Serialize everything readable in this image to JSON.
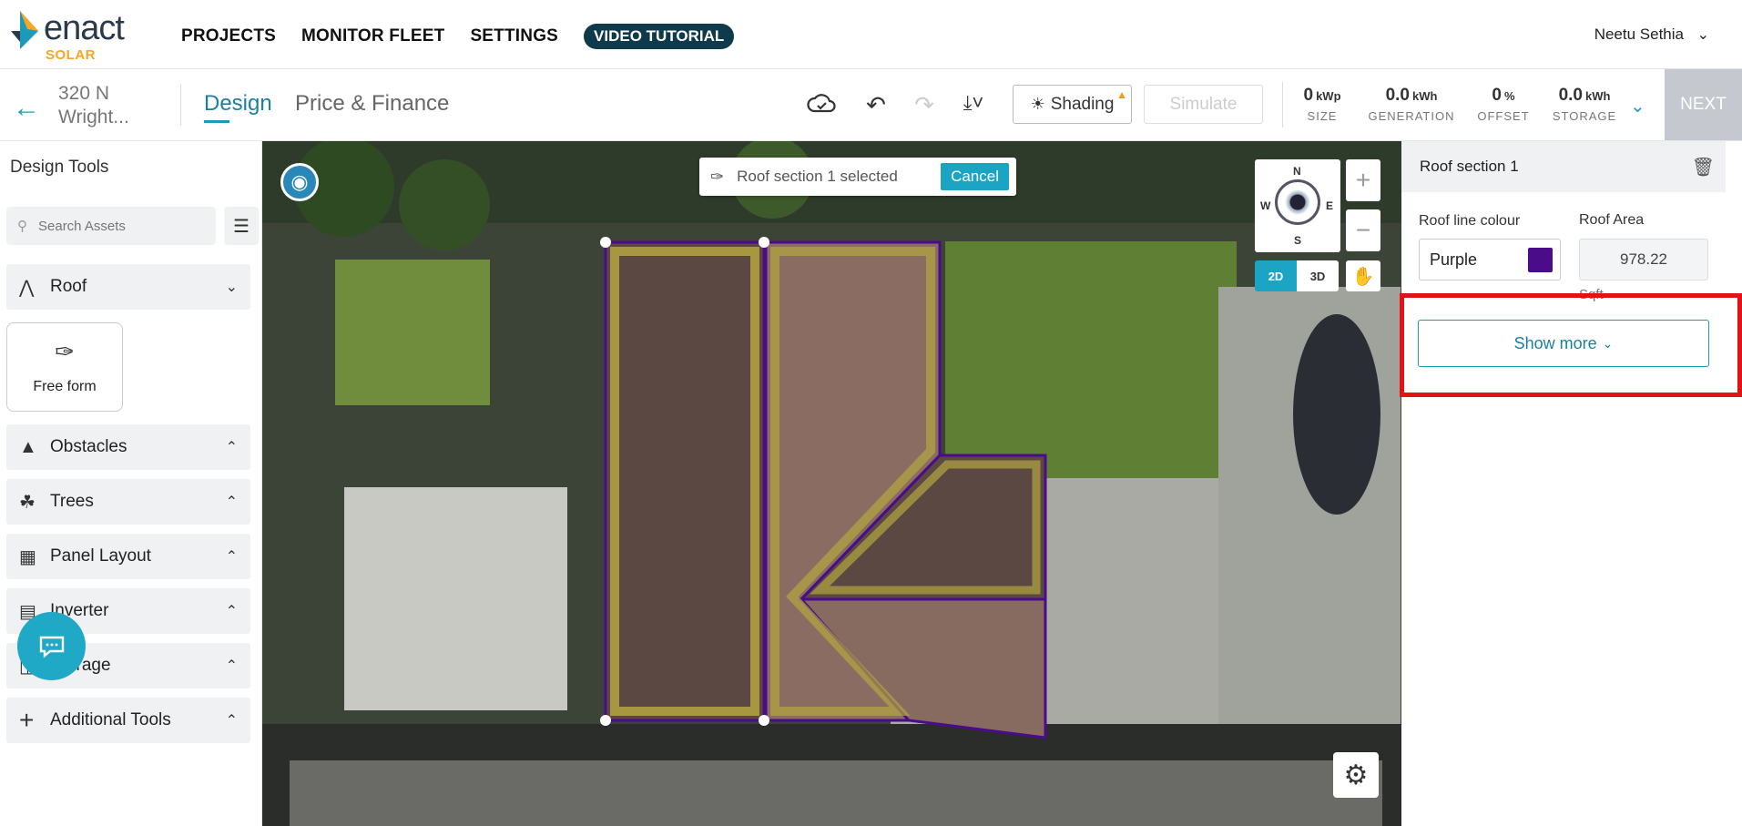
{
  "brand": {
    "name": "enact",
    "sub": "SOLAR"
  },
  "topnav": {
    "items": [
      "PROJECTS",
      "MONITOR FLEET",
      "SETTINGS"
    ],
    "video_tutorial": "VIDEO TUTORIAL",
    "user_name": "Neetu Sethia"
  },
  "project": {
    "name_line1": "320 N",
    "name_line2": "Wright..."
  },
  "tabs": {
    "design": "Design",
    "price_finance": "Price & Finance"
  },
  "toolbar": {
    "shading": "Shading",
    "simulate": "Simulate",
    "next": "NEXT"
  },
  "stats": [
    {
      "value": "0",
      "unit": "kWp",
      "label": "SIZE"
    },
    {
      "value": "0.0",
      "unit": "kWh",
      "label": "GENERATION"
    },
    {
      "value": "0",
      "unit": "%",
      "label": "OFFSET"
    },
    {
      "value": "0.0",
      "unit": "kWh",
      "label": "STORAGE"
    }
  ],
  "left_panel": {
    "title": "Design Tools",
    "search_placeholder": "Search Assets",
    "sections": {
      "roof": "Roof",
      "free_form": "Free form",
      "obstacles": "Obstacles",
      "trees": "Trees",
      "panel_layout": "Panel Layout",
      "inverter": "Inverter",
      "storage": "Storage",
      "additional_tools": "Additional Tools"
    }
  },
  "map": {
    "selection_text": "Roof section 1 selected",
    "cancel": "Cancel",
    "compass": {
      "n": "N",
      "s": "S",
      "e": "E",
      "w": "W"
    },
    "mode_2d": "2D",
    "mode_3d": "3D"
  },
  "right_panel": {
    "title": "Roof section 1",
    "roof_line_colour_label": "Roof line colour",
    "roof_line_colour_value": "Purple",
    "roof_line_colour_hex": "#4b0c8a",
    "roof_area_label": "Roof Area",
    "roof_area_value": "978.22",
    "roof_area_unit": "Sqft",
    "show_more": "Show more"
  },
  "colors": {
    "accent": "#1c9ab8",
    "highlight_box": "#e01414",
    "roof_outline": "#3a0f7a"
  }
}
